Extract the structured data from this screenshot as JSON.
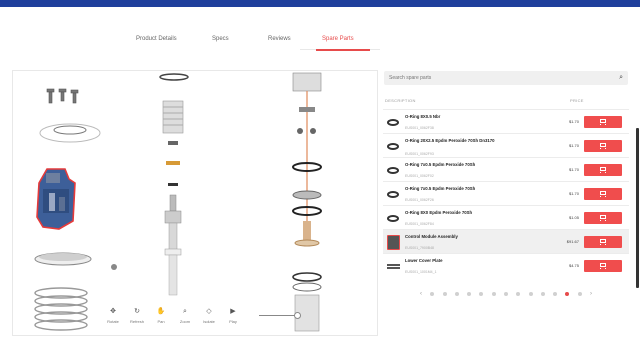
{
  "tabs": [
    {
      "label": "Product Details",
      "active": false
    },
    {
      "label": "Specs",
      "active": false
    },
    {
      "label": "Reviews",
      "active": false
    },
    {
      "label": "Spare Parts",
      "active": true
    }
  ],
  "viewer": {
    "tools": [
      {
        "label": "Rotate",
        "icon": "rotate-icon",
        "glyph": "✥"
      },
      {
        "label": "Refresh",
        "icon": "refresh-icon",
        "glyph": "↻"
      },
      {
        "label": "Pan",
        "icon": "pan-icon",
        "glyph": "✋"
      },
      {
        "label": "Zoom",
        "icon": "zoom-icon",
        "glyph": "⌕"
      },
      {
        "label": "Isolate",
        "icon": "isolate-icon",
        "glyph": "◇"
      },
      {
        "label": "Play",
        "icon": "play-icon",
        "glyph": "▶"
      }
    ]
  },
  "search": {
    "placeholder": "Search spare parts"
  },
  "columns": {
    "description": "DESCRIPTION",
    "price": "PRICE"
  },
  "parts": [
    {
      "name": "O-Ring 8X0.5 Nbr",
      "sku": "EUS001_0062F38",
      "price": "$1.70",
      "thumb": "ring",
      "selected": false
    },
    {
      "name": "O-Ring 20X2.5 Epdm Peroxide 70Sh Dn3170",
      "sku": "EUS001_0062F93",
      "price": "$1.70",
      "thumb": "ring",
      "selected": false
    },
    {
      "name": "O-Ring 7x0.5 Epdm Peroxide 70Sh",
      "sku": "EUS001_0062F02",
      "price": "$1.70",
      "thumb": "ring",
      "selected": false
    },
    {
      "name": "O-Ring 7x0.5 Epdm Peroxide 70Sh",
      "sku": "EUS001_0062F26",
      "price": "$1.70",
      "thumb": "ring",
      "selected": false
    },
    {
      "name": "O-Ring 8X0 Epdm Peroxide 70Sh",
      "sku": "EUS001_0062F84",
      "price": "$1.05",
      "thumb": "ring",
      "selected": false
    },
    {
      "name": "Control Module Assembly",
      "sku": "EUS001_7900B48",
      "price": "$91.67",
      "thumb": "module",
      "selected": true
    },
    {
      "name": "Lower Cover Plate",
      "sku": "EUS001_1001M4_1",
      "price": "$4.75",
      "thumb": "plate",
      "selected": false
    }
  ],
  "pagination": {
    "pages": 13,
    "current": 12
  },
  "colors": {
    "brand_bar": "#1f3f9c",
    "accent": "#e74b4b",
    "cart_button": "#f04d4d"
  }
}
